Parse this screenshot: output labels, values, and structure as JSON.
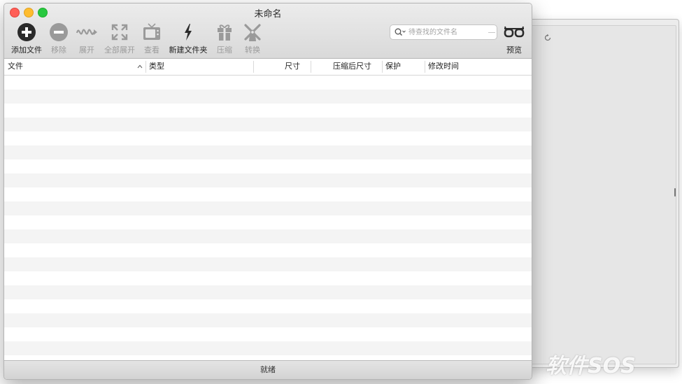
{
  "window": {
    "title": "未命名"
  },
  "toolbar": {
    "add": "添加文件",
    "remove": "移除",
    "expand": "展开",
    "expand_all": "全部展开",
    "view": "查看",
    "new_folder": "新建文件夹",
    "compress": "压缩",
    "convert": "转换",
    "preview": "预览"
  },
  "search": {
    "placeholder": "待查找的文件名"
  },
  "columns": [
    "文件",
    "类型",
    "尺寸",
    "压缩后尺寸",
    "保护",
    "修改时间"
  ],
  "status": "就绪",
  "watermark": "软件SOS"
}
